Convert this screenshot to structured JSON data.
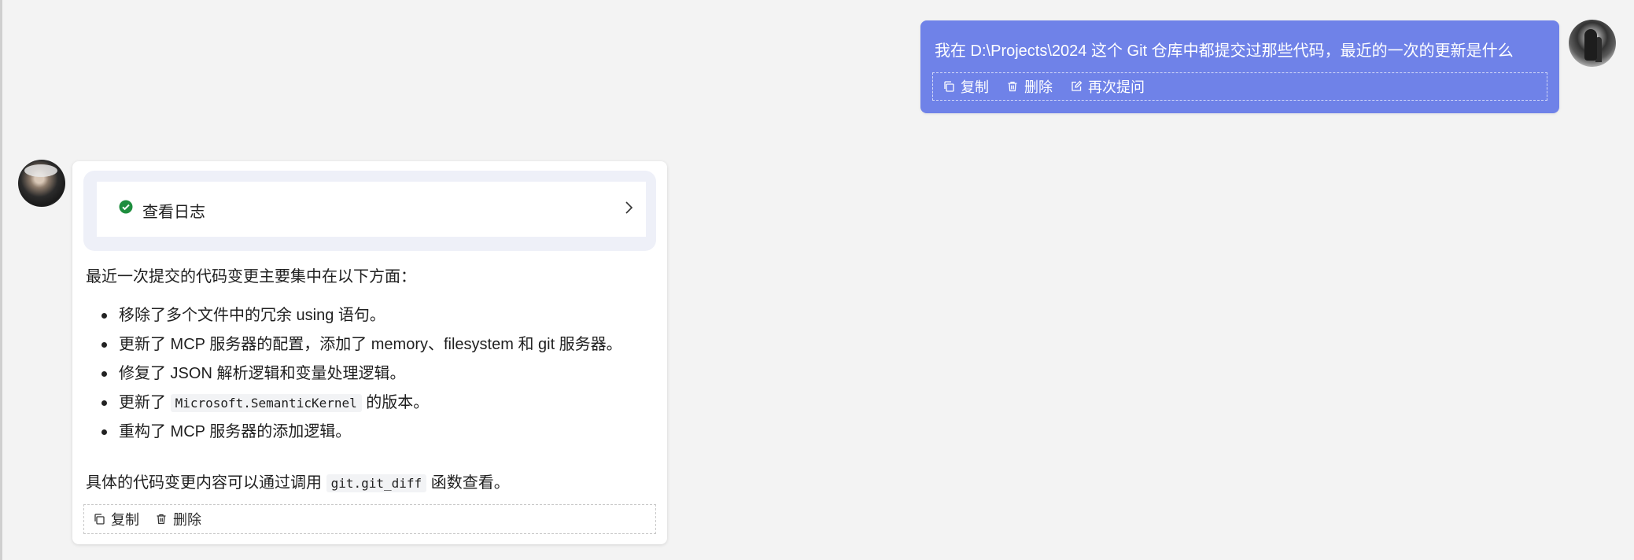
{
  "user": {
    "message": "我在 D:\\Projects\\2024 这个 Git 仓库中都提交过那些代码，最近的一次的更新是什么",
    "actions": {
      "copy": "复制",
      "delete": "删除",
      "reask": "再次提问"
    }
  },
  "assistant": {
    "tool_call": {
      "label": "查看日志",
      "status": "success"
    },
    "intro": "最近一次提交的代码变更主要集中在以下方面：",
    "bullets": [
      {
        "text": "移除了多个文件中的冗余 using 语句。"
      },
      {
        "text": "更新了 MCP 服务器的配置，添加了 memory、filesystem 和 git 服务器。"
      },
      {
        "text": "修复了 JSON 解析逻辑和变量处理逻辑。"
      },
      {
        "prefix": "更新了 ",
        "code": "Microsoft.SemanticKernel",
        "suffix": " 的版本。"
      },
      {
        "text": "重构了 MCP 服务器的添加逻辑。"
      }
    ],
    "outro": {
      "prefix": "具体的代码变更内容可以通过调用 ",
      "code": "git.git_diff",
      "suffix": " 函数查看。"
    },
    "actions": {
      "copy": "复制",
      "delete": "删除"
    }
  },
  "colors": {
    "user_bubble": "#6f82e8",
    "check_green": "#1e8e3e",
    "background": "#f3f3f3"
  },
  "icons": [
    "copy-icon",
    "trash-icon",
    "edit-icon",
    "check-circle-icon",
    "chevron-right-icon"
  ]
}
